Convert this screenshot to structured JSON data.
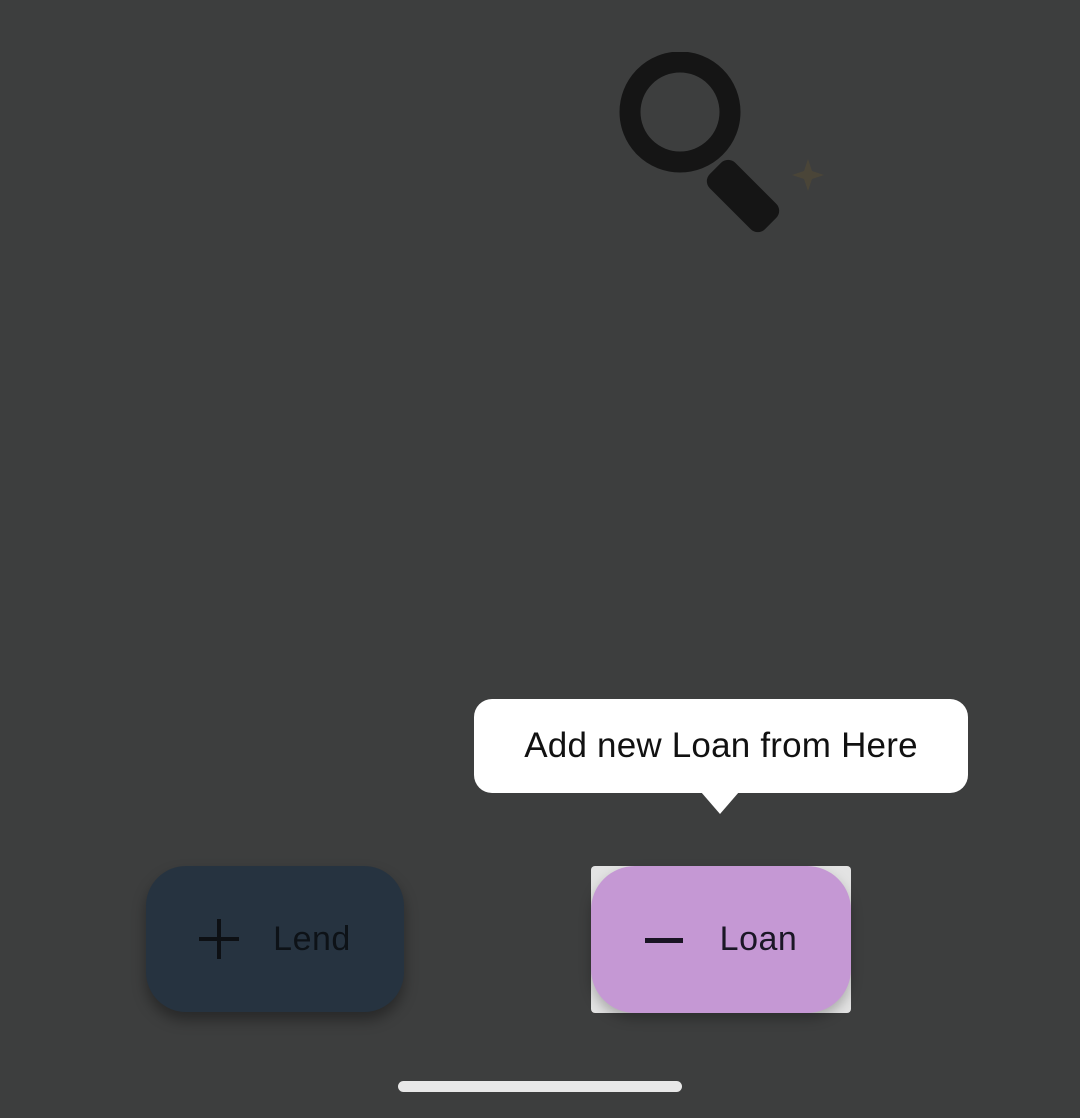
{
  "empty_state": {
    "icon": "magnifier-sparkle-icon"
  },
  "tooltip": {
    "text": "Add new Loan from Here"
  },
  "actions": {
    "lend": {
      "label": "Lend",
      "icon": "plus-icon",
      "color": "#263340"
    },
    "loan": {
      "label": "Loan",
      "icon": "minus-icon",
      "color": "#c598d4"
    }
  },
  "colors": {
    "overlay": "#3d3e3e",
    "tooltip_bg": "#ffffff"
  }
}
